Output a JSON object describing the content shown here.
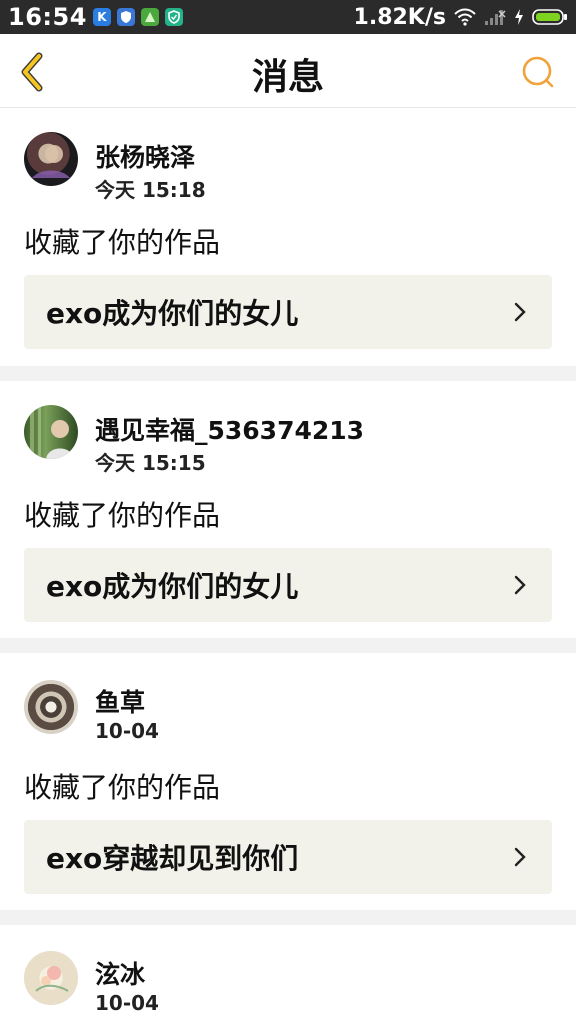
{
  "status_bar": {
    "time": "16:54",
    "net_speed": "1.82K/s",
    "app_icons": [
      {
        "name": "k-app-icon",
        "glyph": "K",
        "color": "#2a7de1"
      },
      {
        "name": "shield-app-icon",
        "glyph": "",
        "color": "#3a78d8"
      },
      {
        "name": "game-app-icon",
        "glyph": "",
        "color": "#4aa83c"
      },
      {
        "name": "vpn-app-icon",
        "glyph": "",
        "color": "#23b28a"
      }
    ]
  },
  "header": {
    "title": "消息"
  },
  "messages": [
    {
      "username": "张杨晓泽",
      "time": "今天 15:18",
      "action": "收藏了你的作品",
      "work_title": "exo成为你们的女儿"
    },
    {
      "username": "遇见幸福_536374213",
      "time": "今天 15:15",
      "action": "收藏了你的作品",
      "work_title": "exo成为你们的女儿"
    },
    {
      "username": "鱼草",
      "time": "10-04",
      "action": "收藏了你的作品",
      "work_title": "exo穿越却见到你们"
    },
    {
      "username": "泫冰",
      "time": "10-04",
      "action": "",
      "work_title": ""
    }
  ],
  "colors": {
    "accent": "#f0a33a",
    "back_arrow": "#f5c520",
    "divider": "#f2f2f2",
    "link_bg": "#f2f2ea"
  }
}
